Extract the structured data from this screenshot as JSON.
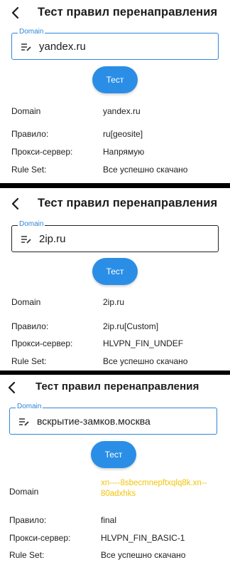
{
  "screens": [
    {
      "title": "Тест правил перенаправления",
      "field_label": "Domain",
      "field_value": "yandex.ru",
      "test_button": "Тест",
      "rows": [
        {
          "label": "Domain",
          "value": "yandex.ru"
        },
        {
          "label": "Правило:",
          "value": "ru[geosite]"
        },
        {
          "label": "Прокси-сервер:",
          "value": "Напрямую"
        },
        {
          "label": "Rule Set:",
          "value": "Все успешно скачано"
        }
      ]
    },
    {
      "title": "Тест правил перенаправления",
      "field_label": "Domain",
      "field_value": "2ip.ru",
      "test_button": "Тест",
      "rows": [
        {
          "label": "Domain",
          "value": "2ip.ru"
        },
        {
          "label": "Правило:",
          "value": "2ip.ru[Custom]"
        },
        {
          "label": "Прокси-сервер:",
          "value": "HLVPN_FIN_UNDEF"
        },
        {
          "label": "Rule Set:",
          "value": "Все успешно скачано"
        }
      ]
    },
    {
      "title": "Тест правил перенаправления",
      "field_label": "Domain",
      "field_value": "вскрытие-замков.москва",
      "test_button": "Тест",
      "rows": [
        {
          "label": "Domain",
          "value": "xn----8sbecmnepftxqlq8k.xn--80adxhks"
        },
        {
          "label": "Правило:",
          "value": "final"
        },
        {
          "label": "Прокси-сервер:",
          "value": "HLVPN_FIN_BASIC-1"
        },
        {
          "label": "Rule Set:",
          "value": "Все успешно скачано"
        }
      ]
    }
  ],
  "colors": {
    "accent": "#2b8ee6",
    "field_border_active": "#2c87d9",
    "punycode_highlight": "#f2c40a",
    "divider": "#000000"
  },
  "icons": {
    "back": "arrow-back-icon",
    "field": "edit-note-icon"
  }
}
